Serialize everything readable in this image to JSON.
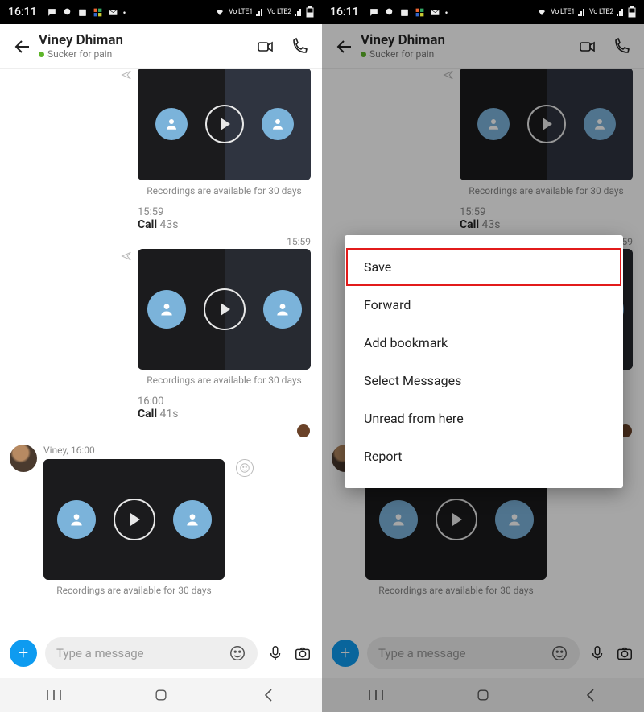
{
  "statusbar": {
    "time": "16:11",
    "net1": "Vo LTE1",
    "net2": "Vo LTE2"
  },
  "header": {
    "name": "Viney Dhiman",
    "status": "Sucker for pain"
  },
  "messages": {
    "rec1": {
      "caption": "Recordings are available for 30 days"
    },
    "call1": {
      "time": "15:59",
      "label": "Call",
      "duration": "43s"
    },
    "rec2": {
      "time": "15:59",
      "caption": "Recordings are available for 30 days"
    },
    "call2": {
      "time": "16:00",
      "label": "Call",
      "duration": "41s"
    },
    "incoming": {
      "meta": "Viney, 16:00",
      "caption": "Recordings are available for 30 days"
    }
  },
  "composer": {
    "placeholder": "Type a message"
  },
  "context_menu": {
    "items": [
      "Save",
      "Forward",
      "Add bookmark",
      "Select Messages",
      "Unread from here",
      "Report"
    ]
  }
}
